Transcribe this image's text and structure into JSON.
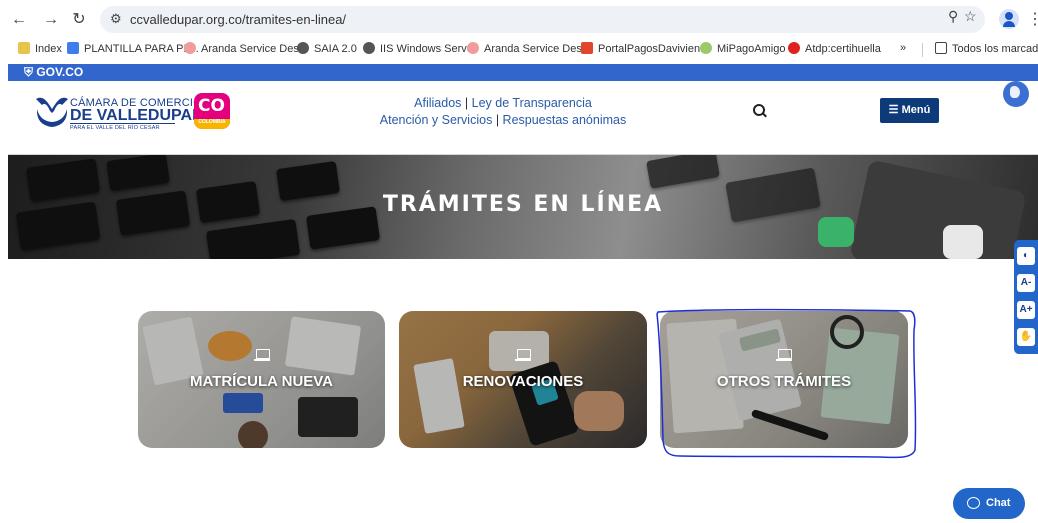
{
  "browser": {
    "url": "ccvalledupar.org.co/tramites-en-linea/",
    "bookmarks": [
      "Index",
      "PLANTILLA PARA PL...",
      "Aranda Service Des...",
      "SAIA 2.0",
      "IIS Windows Server",
      "Aranda Service Des...",
      "PortalPagosDavivien...",
      "MiPagoAmigo",
      "Atdp:certihuella"
    ],
    "overflow_label": "»",
    "all_bookmarks_label": "Todos los marcadores"
  },
  "gov": {
    "label": "GOV.CO"
  },
  "site": {
    "brand_line1": "CÁMARA DE COMERCIO",
    "brand_line2": "DE VALLEDUPAR",
    "brand_line3": "PARA EL VALLE DEL RÍO CESAR",
    "co_badge": "CO",
    "co_badge_sub": "COLOMBIA",
    "nav": {
      "afiliados": "Afiliados",
      "transparencia": "Ley de Transparencia",
      "atencion": "Atención y Servicios",
      "respuestas": "Respuestas anónimas",
      "separator": "|"
    },
    "menu_label": "Menú"
  },
  "banner": {
    "title": "TRÁMITES EN LÍNEA"
  },
  "cards": [
    {
      "label": "MATRÍCULA NUEVA"
    },
    {
      "label": "RENOVACIONES"
    },
    {
      "label": "OTROS TRÁMITES"
    }
  ],
  "accessibility": {
    "contrast": "◐",
    "decrease": "A-",
    "increase": "A+",
    "sign_language": "✋"
  },
  "chat": {
    "label": "Chat"
  },
  "colors": {
    "govbar": "#3366cc",
    "brand_blue": "#1a3e8c",
    "menu_button": "#0d3a78",
    "link_blue": "#2b5ba8",
    "accessibility_bar": "#2166c8",
    "annotation": "#1f2fd6"
  }
}
